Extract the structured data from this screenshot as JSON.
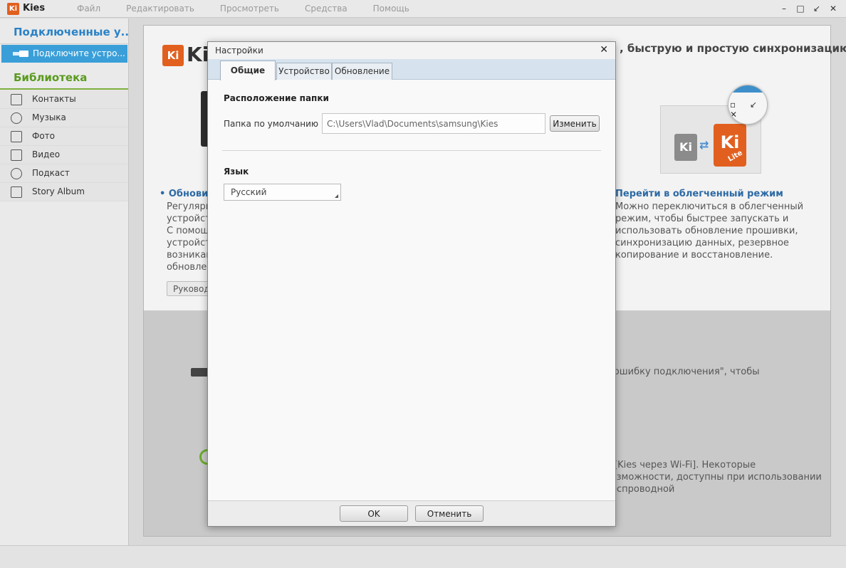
{
  "app": {
    "logo_text": "Ki",
    "title": "Kies",
    "menu": [
      "Файл",
      "Редактировать",
      "Просмотреть",
      "Средства",
      "Помощь"
    ],
    "window_controls": {
      "minimize": "–",
      "restore": "□",
      "compact": "↙",
      "close": "✕"
    }
  },
  "sidebar": {
    "connected_heading": "Подключенные у...",
    "device_item": "Подключите устро...",
    "library_heading": "Библиотека",
    "items": [
      {
        "label": "Контакты",
        "icon": "contacts-icon"
      },
      {
        "label": "Музыка",
        "icon": "music-icon"
      },
      {
        "label": "Фото",
        "icon": "photo-icon"
      },
      {
        "label": "Видео",
        "icon": "video-icon"
      },
      {
        "label": "Подкаст",
        "icon": "podcast-icon"
      },
      {
        "label": "Story Album",
        "icon": "story-album-icon"
      }
    ]
  },
  "main": {
    "logo_text": "Ki",
    "logo_word": "Kie",
    "headline": ", быструю и простую синхронизацию",
    "left_block": {
      "title": "• Обновить",
      "text": [
        "Регулярно",
        "устройств",
        "С помощ",
        "устройств",
        "возникаю",
        "обновлен"
      ],
      "button": "Руководс"
    },
    "right_block": {
      "title": "Перейти в облегченный режим",
      "text": "Можно переключиться в облегченный режим, чтобы быстрее запускать и использовать обновление прошивки, синхронизацию данных, резервное копирование и восстановление."
    },
    "lite_graphic": {
      "small_k": "Ki",
      "big_k": "Ki",
      "tag": "Lite",
      "zoom_glyphs": "▫ ↙ ✕"
    },
    "bottom_line1": "ь ошибку подключения\", чтобы",
    "bottom_line2": "о [Kies через Wi-Fi]. Некоторые возможности, доступны при использовании беспроводной"
  },
  "dialog": {
    "title": "Настройки",
    "close": "✕",
    "tabs": [
      {
        "label": "Общие",
        "active": true
      },
      {
        "label": "Устройство",
        "active": false
      },
      {
        "label": "Обновление",
        "active": false
      }
    ],
    "folder_section_title": "Расположение папки",
    "default_folder_label": "Папка по умолчанию :",
    "default_folder_value": "C:\\Users\\Vlad\\Documents\\samsung\\Kies",
    "change_button": "Изменить",
    "language_section_title": "Язык",
    "language_value": "Русский",
    "ok_button": "OK",
    "cancel_button": "Отменить"
  }
}
